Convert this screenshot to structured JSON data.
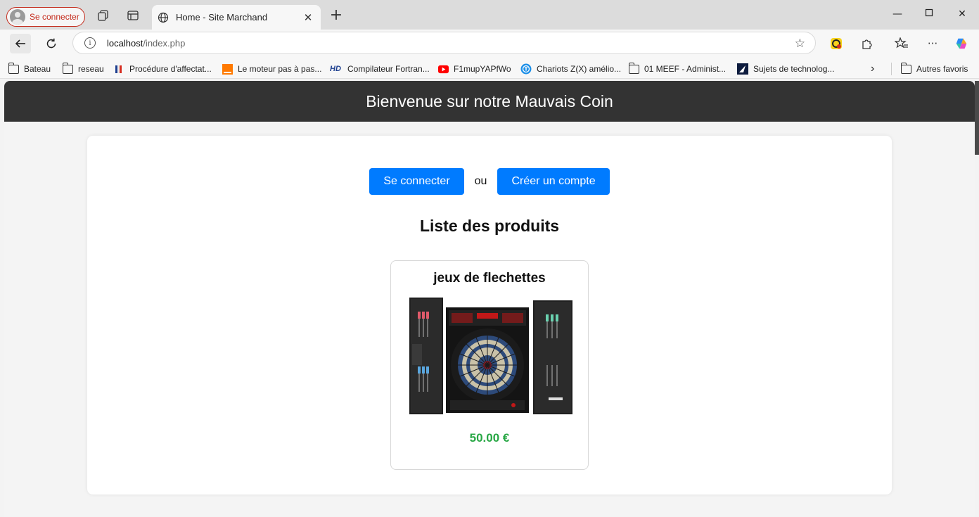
{
  "browser": {
    "profile_label": "Se connecter",
    "tab_title": "Home - Site Marchand",
    "url_host": "localhost",
    "url_path": "/index.php",
    "bookmarks": [
      {
        "label": "Bateau",
        "icon": "folder-icon"
      },
      {
        "label": "reseau",
        "icon": "folder-icon"
      },
      {
        "label": "Procédure d'affectat...",
        "icon": "marianne-icon"
      },
      {
        "label": "Le moteur pas à pas...",
        "icon": "orange-icon"
      },
      {
        "label": "Compilateur Fortran...",
        "icon": "hd-icon"
      },
      {
        "label": "F1mupYAPfWo",
        "icon": "youtube-icon"
      },
      {
        "label": "Chariots Z(X) amélio...",
        "icon": "tinkercad-icon"
      },
      {
        "label": "01 MEEF - Administ...",
        "icon": "folder-icon"
      },
      {
        "label": "Sujets de technolog...",
        "icon": "sujets-icon"
      }
    ],
    "other_favorites": "Autres favoris"
  },
  "site": {
    "header_title": "Bienvenue sur notre Mauvais Coin",
    "login_button": "Se connecter",
    "or_text": "ou",
    "register_button": "Créer un compte",
    "list_title": "Liste des produits",
    "products": [
      {
        "name": "jeux de flechettes",
        "price": "50.00 €",
        "image": "dartboard-cabinet"
      }
    ]
  },
  "colors": {
    "header_bg": "#333333",
    "button_bg": "#007bff",
    "price_color": "#28a745",
    "profile_accent": "#c42b1c"
  }
}
